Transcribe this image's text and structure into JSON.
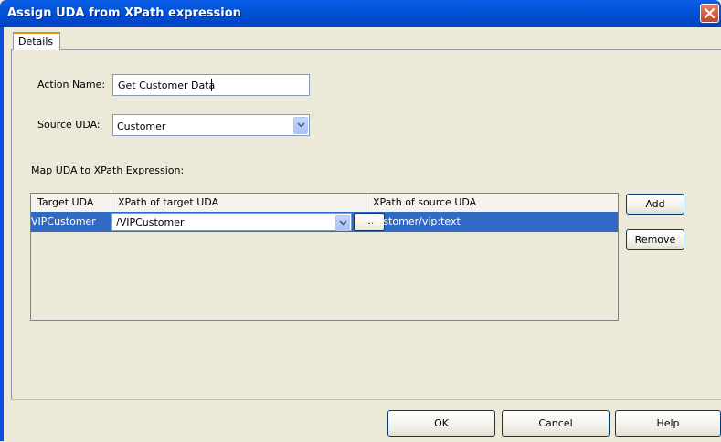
{
  "window": {
    "title": "Assign UDA from XPath expression"
  },
  "tabs": [
    {
      "label": "Details"
    }
  ],
  "form": {
    "action_name_label": "Action Name:",
    "action_name_value": "Get Customer Data",
    "source_uda_label": "Source UDA:",
    "source_uda_value": "Customer",
    "map_label": "Map UDA to XPath Expression:"
  },
  "table": {
    "columns": [
      "Target UDA",
      "XPath of target UDA",
      "XPath of source UDA"
    ],
    "rows": [
      {
        "target_uda": "VIPCustomer",
        "xpath_target": "/VIPCustomer",
        "browse": "...",
        "xpath_source": "/Customer/vip:text"
      }
    ]
  },
  "side_buttons": {
    "add": "Add",
    "remove": "Remove"
  },
  "footer_buttons": {
    "ok": "OK",
    "cancel": "Cancel",
    "help": "Help"
  },
  "colors": {
    "title_bar": "#0054e3",
    "selection": "#316ac5",
    "dialog_bg": "#ece9d8"
  }
}
